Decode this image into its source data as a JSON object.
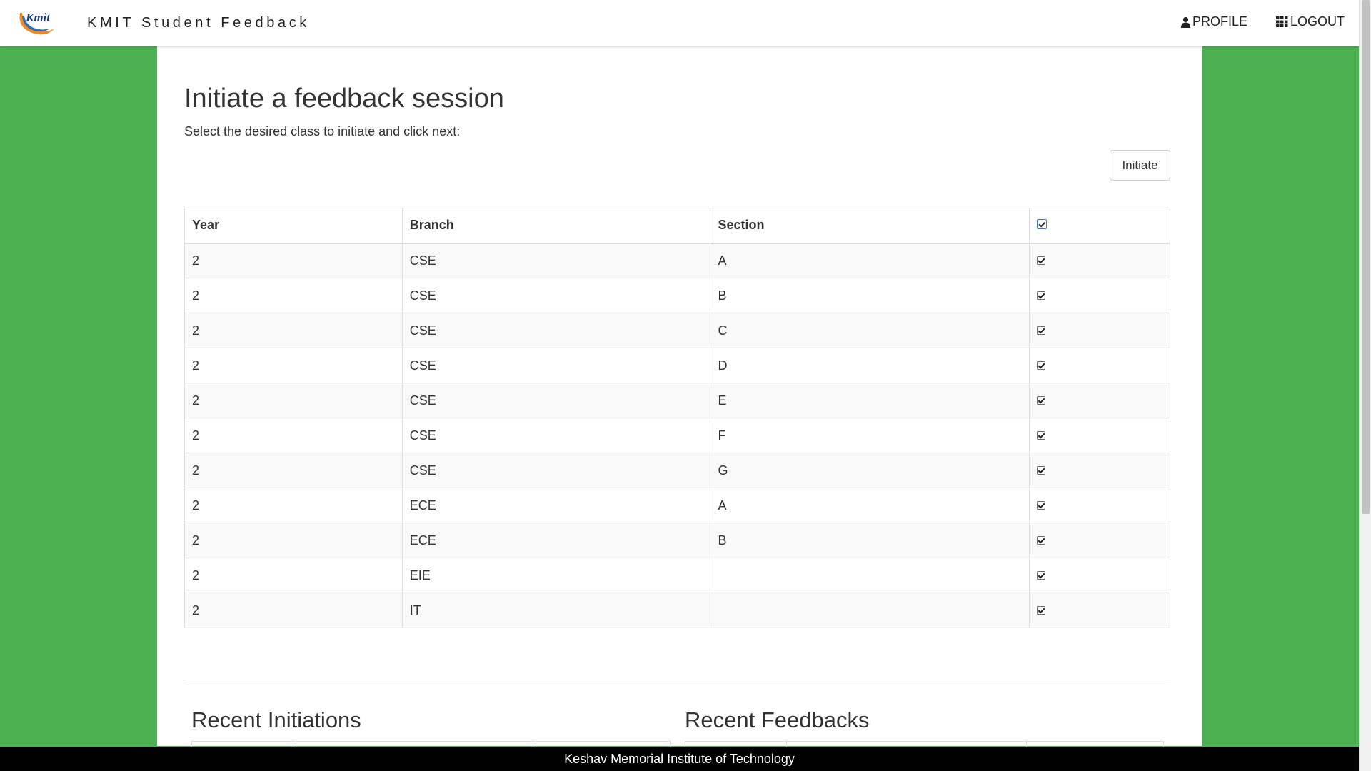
{
  "navbar": {
    "logo_text": "Kmit",
    "brand": "KMIT Student Feedback",
    "profile_label": "PROFILE",
    "logout_label": "LOGOUT"
  },
  "main": {
    "title": "Initiate a feedback session",
    "subtitle": "Select the desired class to initiate and click next:",
    "initiate_label": "Initiate",
    "table": {
      "headers": [
        "Year",
        "Branch",
        "Section"
      ],
      "select_all_checked": true,
      "rows": [
        {
          "year": "2",
          "branch": "CSE",
          "section": "A",
          "checked": true
        },
        {
          "year": "2",
          "branch": "CSE",
          "section": "B",
          "checked": true
        },
        {
          "year": "2",
          "branch": "CSE",
          "section": "C",
          "checked": true
        },
        {
          "year": "2",
          "branch": "CSE",
          "section": "D",
          "checked": true
        },
        {
          "year": "2",
          "branch": "CSE",
          "section": "E",
          "checked": true
        },
        {
          "year": "2",
          "branch": "CSE",
          "section": "F",
          "checked": true
        },
        {
          "year": "2",
          "branch": "CSE",
          "section": "G",
          "checked": true
        },
        {
          "year": "2",
          "branch": "ECE",
          "section": "A",
          "checked": true
        },
        {
          "year": "2",
          "branch": "ECE",
          "section": "B",
          "checked": true
        },
        {
          "year": "2",
          "branch": "EIE",
          "section": "",
          "checked": true
        },
        {
          "year": "2",
          "branch": "IT",
          "section": "",
          "checked": true
        }
      ]
    },
    "recent_initiations_title": "Recent Initiations",
    "recent_feedbacks_title": "Recent Feedbacks"
  },
  "footer": {
    "text": "Keshav Memorial Institute of Technology"
  },
  "colors": {
    "background_green": "#4caf50",
    "footer_bg": "#000000",
    "logo_orange": "#f08a24",
    "logo_blue": "#2f6db5"
  },
  "icons": {
    "profile": "user-icon",
    "logout": "grid-icon"
  }
}
